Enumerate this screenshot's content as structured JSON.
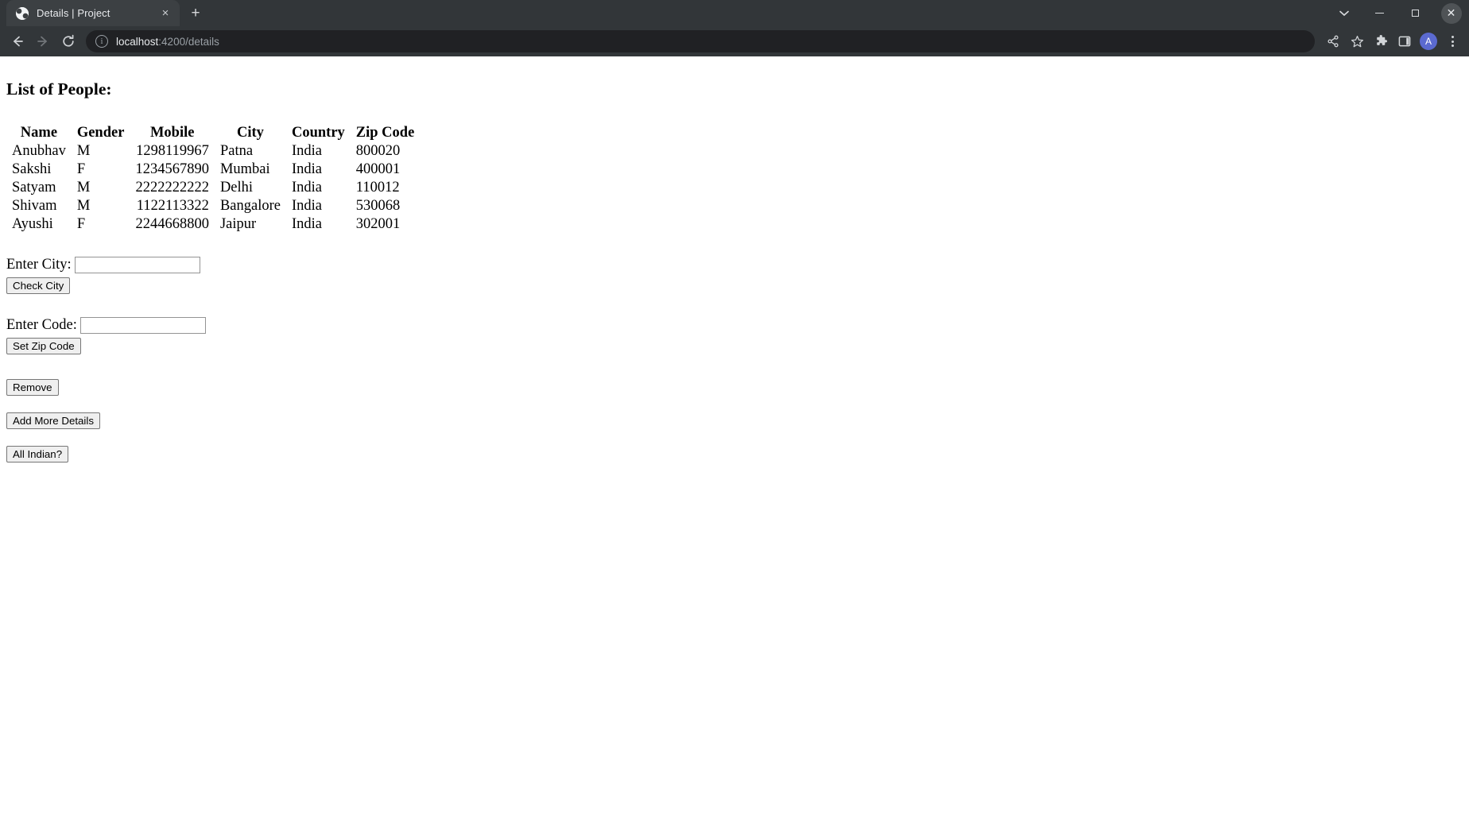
{
  "browser": {
    "tab": {
      "title": "Details | Project",
      "favicon_name": "site-favicon",
      "close_label": "×"
    },
    "new_tab_label": "+",
    "window_controls": {
      "chevron_label": "⌄",
      "minimize_label": "minimize",
      "maximize_label": "maximize",
      "close_label": "✕"
    },
    "nav": {
      "back_label": "back",
      "forward_label": "forward",
      "reload_label": "reload"
    },
    "omnibox": {
      "info_label": "i",
      "host": "localhost",
      "path": ":4200/details",
      "full_url": "localhost:4200/details"
    },
    "toolbar_right": {
      "share_label": "share",
      "bookmark_label": "bookmark",
      "extensions_label": "extensions",
      "sidepanel_label": "side panel",
      "avatar_initial": "A",
      "menu_label": "menu"
    }
  },
  "page": {
    "heading": "List of People:",
    "table": {
      "columns": [
        "Name",
        "Gender",
        "Mobile",
        "City",
        "Country",
        "Zip Code"
      ],
      "rows": [
        {
          "name": "Anubhav",
          "gender": "M",
          "mobile": "1298119967",
          "city": "Patna",
          "country": "India",
          "zip": "800020"
        },
        {
          "name": "Sakshi",
          "gender": "F",
          "mobile": "1234567890",
          "city": "Mumbai",
          "country": "India",
          "zip": "400001"
        },
        {
          "name": "Satyam",
          "gender": "M",
          "mobile": "2222222222",
          "city": "Delhi",
          "country": "India",
          "zip": "110012"
        },
        {
          "name": "Shivam",
          "gender": "M",
          "mobile": "1122113322",
          "city": "Bangalore",
          "country": "India",
          "zip": "530068"
        },
        {
          "name": "Ayushi",
          "gender": "F",
          "mobile": "2244668800",
          "city": "Jaipur",
          "country": "India",
          "zip": "302001"
        }
      ]
    },
    "city_form": {
      "label": "Enter City:",
      "input_value": "",
      "input_placeholder": "",
      "button_label": "Check City"
    },
    "code_form": {
      "label": "Enter Code:",
      "input_value": "",
      "input_placeholder": "",
      "button_label": "Set Zip Code"
    },
    "actions": {
      "remove_label": "Remove",
      "add_more_label": "Add More Details",
      "all_indian_label": "All Indian?"
    }
  },
  "colors": {
    "chrome_bg": "#323639",
    "tab_bg": "#3c4043",
    "omnibox_bg": "#202124",
    "avatar": "#5b6ad0",
    "page_bg": "#ffffff"
  }
}
